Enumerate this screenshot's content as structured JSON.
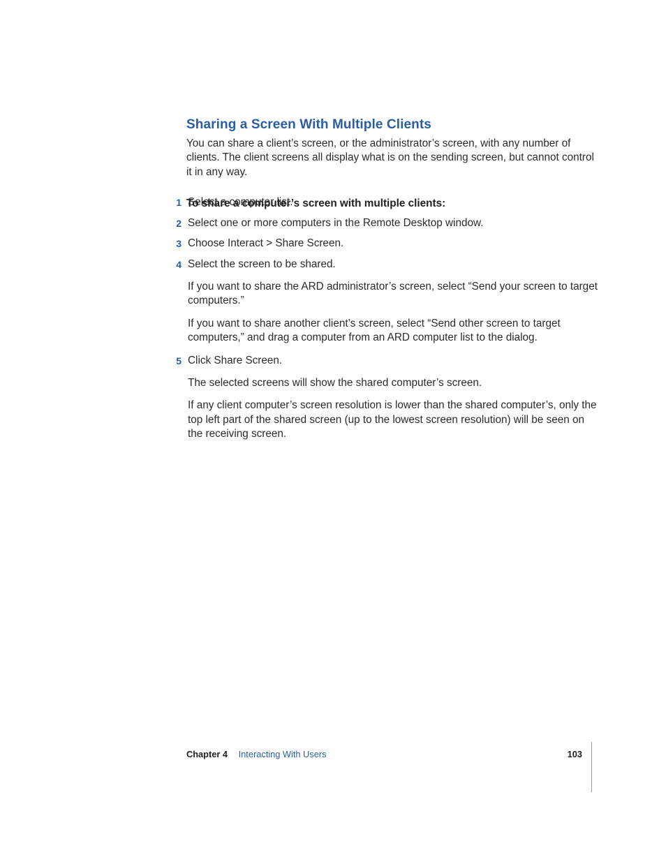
{
  "heading": "Sharing a Screen With Multiple Clients",
  "intro": "You can share a client’s screen, or the administrator’s screen, with any number of clients. The client screens all display what is on the sending screen, but cannot control it in any way.",
  "subhead": "To share a computer’s screen with multiple clients:",
  "steps": [
    {
      "n": "1",
      "paras": [
        "Select a computer list."
      ]
    },
    {
      "n": "2",
      "paras": [
        "Select one or more computers in the Remote Desktop window."
      ]
    },
    {
      "n": "3",
      "paras": [
        "Choose Interact > Share Screen."
      ]
    },
    {
      "n": "4",
      "paras": [
        "Select the screen to be shared.",
        "If you want to share the ARD administrator’s screen, select “Send your screen to target computers.”",
        "If you want to share another client’s screen, select “Send other screen to target computers,” and drag a computer from an ARD computer list to the dialog."
      ]
    },
    {
      "n": "5",
      "paras": [
        "Click Share Screen.",
        "The selected screens will show the shared computer’s screen.",
        "If any client computer’s screen resolution is lower than the shared computer’s, only the top left part of the shared screen (up to the lowest screen resolution) will be seen on the receiving screen."
      ]
    }
  ],
  "footer": {
    "chapter_label": "Chapter 4",
    "chapter_title": "Interacting With Users",
    "page_number": "103"
  }
}
